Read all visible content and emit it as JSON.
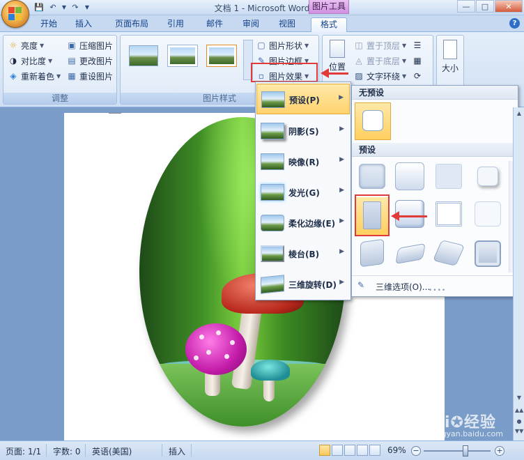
{
  "window": {
    "title": "文档 1 - Microsoft Word",
    "context_tab": "图片工具"
  },
  "tabs": [
    "开始",
    "插入",
    "页面布局",
    "引用",
    "邮件",
    "审阅",
    "视图",
    "格式"
  ],
  "active_tab": "格式",
  "ribbon": {
    "adjust": {
      "label": "调整",
      "brightness": "亮度",
      "contrast": "对比度",
      "recolor": "重新着色",
      "compress": "压缩图片",
      "change": "更改图片",
      "reset": "重设图片"
    },
    "styles": {
      "label": "图片样式",
      "shape": "图片形状",
      "border": "图片边框",
      "effects": "图片效果"
    },
    "arrange": {
      "position": "位置",
      "bring_front": "置于顶层",
      "send_back": "置于底层",
      "text_wrap": "文字环绕"
    },
    "size": {
      "label": "大小"
    }
  },
  "effects_menu": {
    "items": [
      {
        "label": "预设(P)",
        "highlighted": true
      },
      {
        "label": "阴影(S)",
        "highlighted": false
      },
      {
        "label": "映像(R)",
        "highlighted": false
      },
      {
        "label": "发光(G)",
        "highlighted": false
      },
      {
        "label": "柔化边缘(E)",
        "highlighted": false
      },
      {
        "label": "棱台(B)",
        "highlighted": false
      },
      {
        "label": "三维旋转(D)",
        "highlighted": false
      }
    ]
  },
  "preset_submenu": {
    "no_preset_header": "无预设",
    "preset_header": "预设",
    "footer": "三维选项(O)..."
  },
  "statusbar": {
    "page": "页面: 1/1",
    "words": "字数: 0",
    "language": "英语(美国)",
    "mode": "插入",
    "zoom": "69%"
  },
  "watermark": {
    "brand": "Bai",
    "brand_tail": "经验",
    "url": "jingyan.baidu.com"
  },
  "colors": {
    "highlight_red": "#e23a3a",
    "menu_highlight": "#ffd36e",
    "ribbon_blue": "#c6d9f1",
    "context_tab": "#d190e0"
  }
}
